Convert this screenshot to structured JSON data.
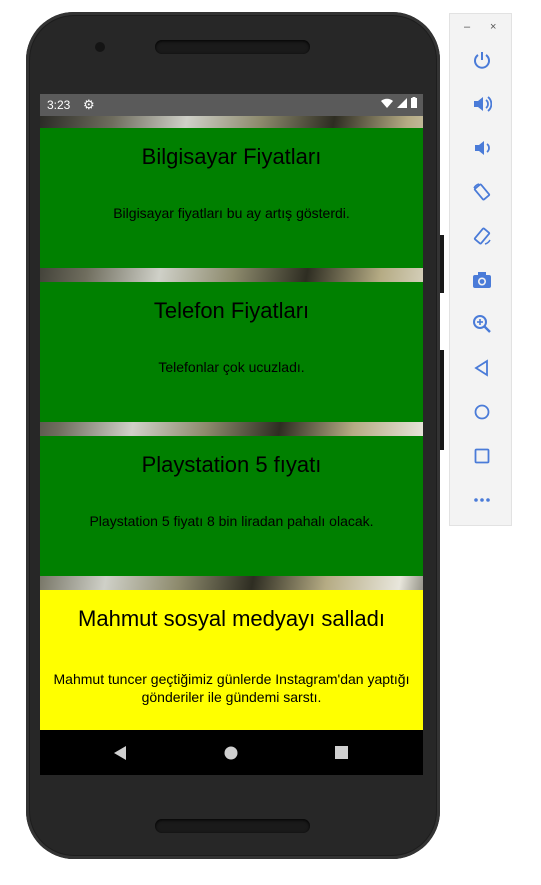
{
  "statusbar": {
    "time": "3:23"
  },
  "cards": [
    {
      "title": "Bilgisayar Fiyatları",
      "body": "Bilgisayar fiyatları bu ay artış gösterdi."
    },
    {
      "title": "Telefon Fiyatları",
      "body": "Telefonlar çok ucuzladı."
    },
    {
      "title": "Playstation 5 fıyatı",
      "body": "Playstation 5 fiyatı 8 bin liradan pahalı olacak."
    },
    {
      "title": "Mahmut sosyal medyayı salladı",
      "body": "Mahmut tuncer geçtiğimiz günlerde Instagram'dan yaptığı gönderiler ile gündemi sarstı."
    }
  ],
  "colors": {
    "green_card": "#008000",
    "yellow_card": "#ffff00",
    "toolbar_icon": "#4a7bd8"
  },
  "toolbar": {
    "minimize": "–",
    "close": "×",
    "icons": [
      "power-icon",
      "volume-up-icon",
      "volume-down-icon",
      "rotate-left-icon",
      "rotate-right-icon",
      "camera-icon",
      "zoom-icon",
      "back-icon",
      "home-icon",
      "overview-icon",
      "more-icon"
    ]
  }
}
